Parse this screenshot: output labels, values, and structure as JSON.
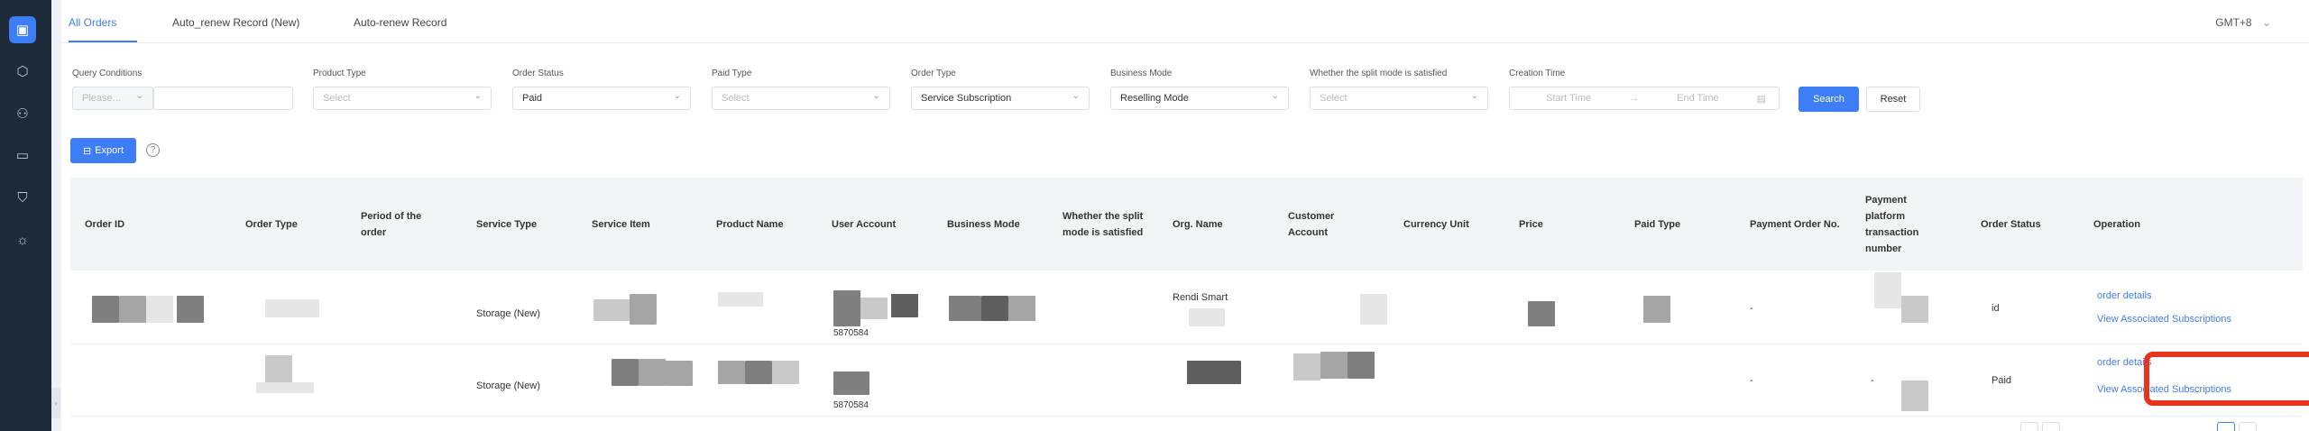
{
  "sidebar": {
    "icons": [
      {
        "name": "orders-icon",
        "glyph": "▣",
        "active": true
      },
      {
        "name": "cube-icon",
        "glyph": "⬡",
        "active": false
      },
      {
        "name": "user-icon",
        "glyph": "⚇",
        "active": false
      },
      {
        "name": "box-icon",
        "glyph": "▭",
        "active": false
      },
      {
        "name": "shield-icon",
        "glyph": "⛉",
        "active": false
      },
      {
        "name": "bulb-icon",
        "glyph": "☼",
        "active": false
      }
    ],
    "collapse_glyph": "›"
  },
  "tabs": [
    "All Orders",
    "Auto_renew Record (New)",
    "Auto-renew Record"
  ],
  "timezone": {
    "label": "GMT+8",
    "chevron": "⌄"
  },
  "filters": {
    "query_conditions": {
      "label": "Query Conditions",
      "placeholder": "Please...",
      "chevron": "⌄"
    },
    "product_type": {
      "label": "Product Type",
      "placeholder": "Select"
    },
    "order_status": {
      "label": "Order Status",
      "value": "Paid"
    },
    "paid_type": {
      "label": "Paid Type",
      "placeholder": "Select"
    },
    "order_type": {
      "label": "Order Type",
      "value": "Service Subscription"
    },
    "business_mode": {
      "label": "Business Mode",
      "value": "Reselling Mode"
    },
    "split_mode": {
      "label": "Whether the split mode is satisfied",
      "placeholder": "Select"
    },
    "creation_time": {
      "label": "Creation Time",
      "start_placeholder": "Start Time",
      "separator": "→",
      "end_placeholder": "End Time",
      "calendar_glyph": "▤"
    },
    "chevron": "⌄"
  },
  "buttons": {
    "search": "Search",
    "reset": "Reset",
    "export": "Export",
    "export_glyph": "⊟",
    "help": "?"
  },
  "columns": [
    "Order ID",
    "Order Type",
    "Period of the order",
    "Service Type",
    "Service Item",
    "Product Name",
    "User Account",
    "Business Mode",
    "Whether the split mode is satisfied",
    "Org. Name",
    "Customer Account",
    "Currency Unit",
    "Price",
    "Paid Type",
    "Payment Order No.",
    "Payment platform transaction number",
    "Order Status",
    "Operation"
  ],
  "rows": [
    {
      "service_type": "Storage (New)",
      "user_account_suffix": "5870584",
      "org_name": "Rendi Smart",
      "payment_order_no": "-",
      "order_status": "",
      "order_status_partial": "id",
      "actions": {
        "details": "order details",
        "subscriptions": "View Associated Subscriptions"
      }
    },
    {
      "service_type": "Storage (New)",
      "user_account_suffix": "5870584",
      "org_name": "",
      "payment_order_no": "-",
      "transaction_no": "-",
      "order_status": "Paid",
      "actions": {
        "details": "order details",
        "subscriptions": "View Associated Subscriptions"
      }
    }
  ],
  "colors": {
    "accent": "#3d7df5",
    "sidebar": "#1d2a3a",
    "highlight": "#e8341f"
  }
}
